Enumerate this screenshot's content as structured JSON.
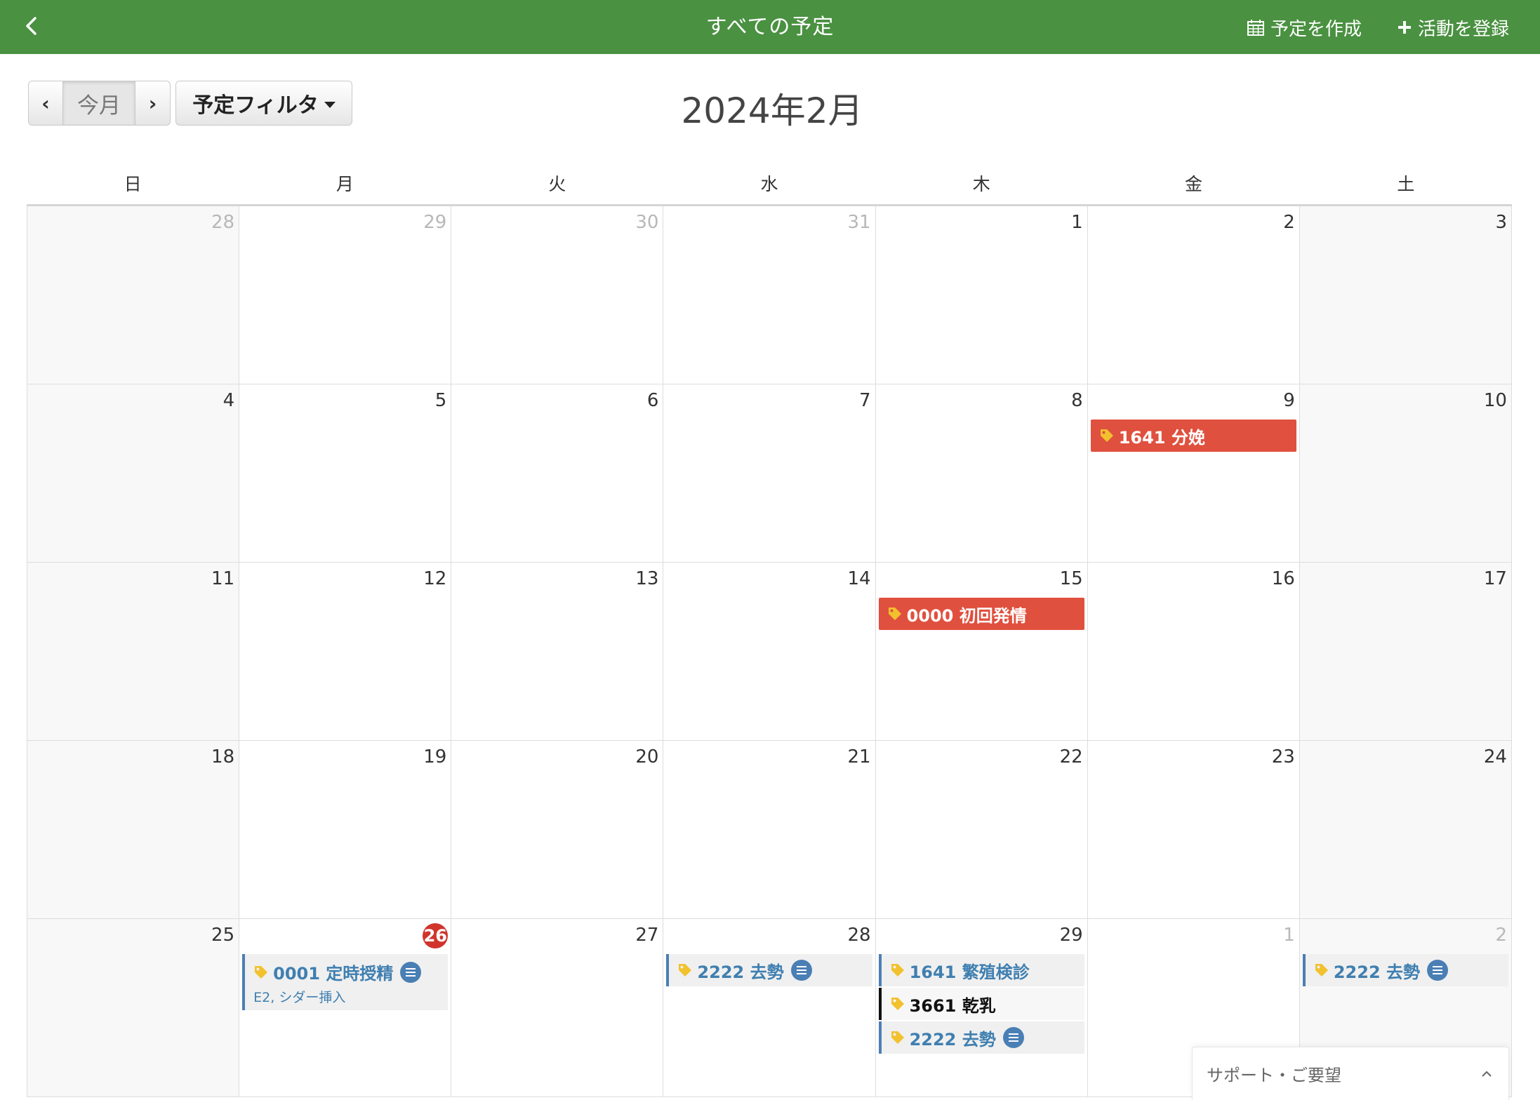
{
  "header": {
    "title": "すべての予定",
    "create_label": "予定を作成",
    "log_label": "活動を登録",
    "color": "#4a9141"
  },
  "toolbar": {
    "prev": "‹",
    "today": "今月",
    "next": "›",
    "filter": "予定フィルタ"
  },
  "month_title": "2024年2月",
  "weekdays": [
    "日",
    "月",
    "火",
    "水",
    "木",
    "金",
    "土"
  ],
  "weeks": [
    [
      "28",
      "29",
      "30",
      "31",
      "1",
      "2",
      "3"
    ],
    [
      "4",
      "5",
      "6",
      "7",
      "8",
      "9",
      "10"
    ],
    [
      "11",
      "12",
      "13",
      "14",
      "15",
      "16",
      "17"
    ],
    [
      "18",
      "19",
      "20",
      "21",
      "22",
      "23",
      "24"
    ],
    [
      "25",
      "26",
      "27",
      "28",
      "29",
      "1",
      "2"
    ]
  ],
  "events": {
    "feb9": {
      "text": "1641 分娩",
      "color": "#e0503e"
    },
    "feb15": {
      "text": "0000 初回発情",
      "color": "#e0503e"
    },
    "feb26": {
      "text": "0001 定時授精",
      "sub": "E2, シダー挿入"
    },
    "feb28": {
      "text": "2222 去勢"
    },
    "feb29a": {
      "text": "1641 繁殖検診"
    },
    "feb29b": {
      "text": "3661 乾乳"
    },
    "feb29c": {
      "text": "2222 去勢"
    },
    "mar2": {
      "text": "2222 去勢"
    }
  },
  "support": {
    "label": "サポート・ご要望",
    "icon": "chevron-up-icon"
  },
  "colors": {
    "today_badge": "#d0342c",
    "event_blue": "#4a7fb5",
    "tag_yellow": "#f2c12e"
  }
}
